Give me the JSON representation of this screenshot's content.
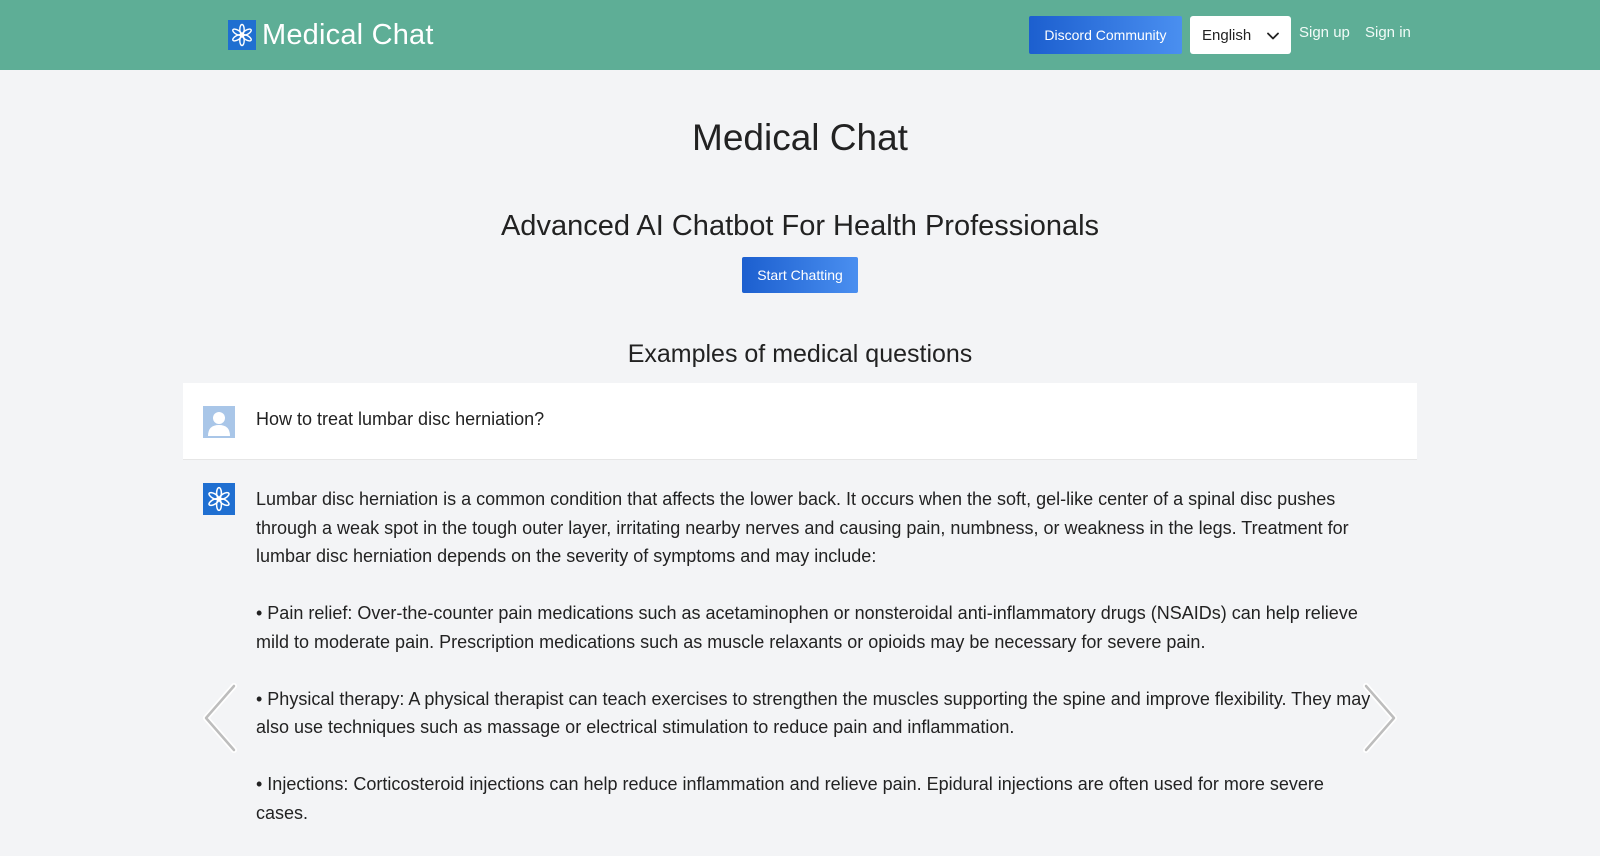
{
  "header": {
    "brand_name": "Medical Chat",
    "brand_icon": "snowflake-star-icon",
    "discord_label": "Discord Community",
    "language_selected": "English",
    "signup_label": "Sign up",
    "signin_label": "Sign in",
    "background_color": "#5eae96"
  },
  "hero": {
    "title": "Medical Chat",
    "subtitle": "Advanced AI Chatbot For Health Professionals",
    "start_label": "Start Chatting",
    "accent_color": "#1c5fcf"
  },
  "examples": {
    "title": "Examples of medical questions",
    "question": "How to treat lumbar disc herniation?",
    "answer_paragraphs": [
      "Lumbar disc herniation is a common condition that affects the lower back. It occurs when the soft, gel-like center of a spinal disc pushes through a weak spot in the tough outer layer, irritating nearby nerves and causing pain, numbness, or weakness in the legs. Treatment for lumbar disc herniation depends on the severity of symptoms and may include:",
      "• Pain relief: Over-the-counter pain medications such as acetaminophen or nonsteroidal anti-inflammatory drugs (NSAIDs) can help relieve mild to moderate pain. Prescription medications such as muscle relaxants or opioids may be necessary for severe pain.",
      "• Physical therapy: A physical therapist can teach exercises to strengthen the muscles supporting the spine and improve flexibility. They may also use techniques such as massage or electrical stimulation to reduce pain and inflammation.",
      "• Injections: Corticosteroid injections can help reduce inflammation and relieve pain. Epidural injections are often used for more severe cases."
    ]
  },
  "carousel": {
    "prev_icon": "chevron-left-icon",
    "next_icon": "chevron-right-icon"
  }
}
